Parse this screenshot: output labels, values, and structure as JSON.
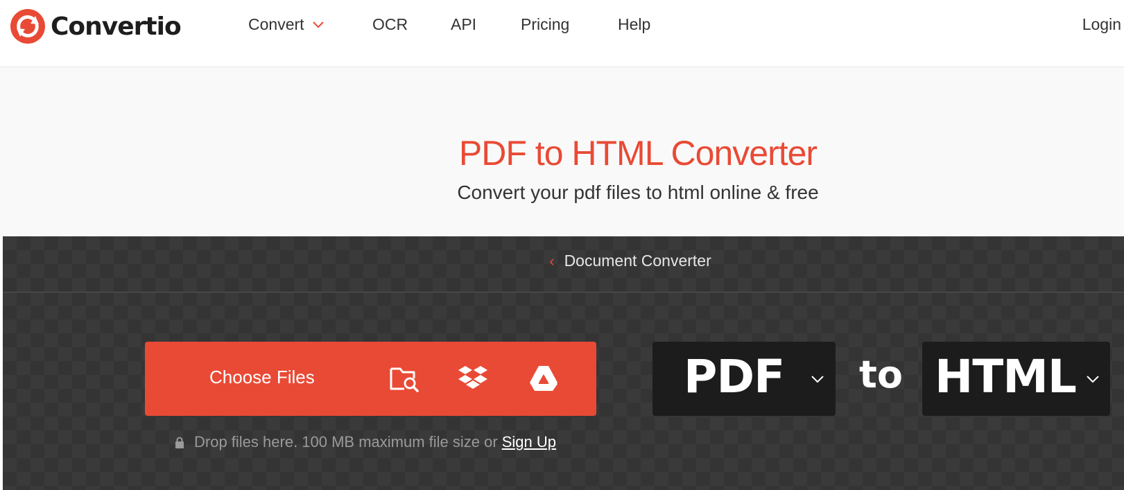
{
  "header": {
    "logo_text": "Convertio",
    "brand_color": "#e94a35",
    "nav": [
      {
        "label": "Convert",
        "has_dropdown": true
      },
      {
        "label": "OCR"
      },
      {
        "label": "API"
      },
      {
        "label": "Pricing"
      },
      {
        "label": "Help"
      }
    ],
    "login_label": "Login"
  },
  "hero": {
    "title": "PDF to HTML Converter",
    "subtitle": "Convert your pdf files to html online & free"
  },
  "tool": {
    "breadcrumb": "Document Converter",
    "choose_files_label": "Choose Files",
    "sources": [
      "folder-search-icon",
      "dropbox-icon",
      "google-drive-icon"
    ],
    "from_format": "PDF",
    "to_word": "to",
    "to_format": "HTML",
    "drop_text": "Drop files here. 100 MB maximum file size or",
    "signup_label": "Sign Up"
  }
}
